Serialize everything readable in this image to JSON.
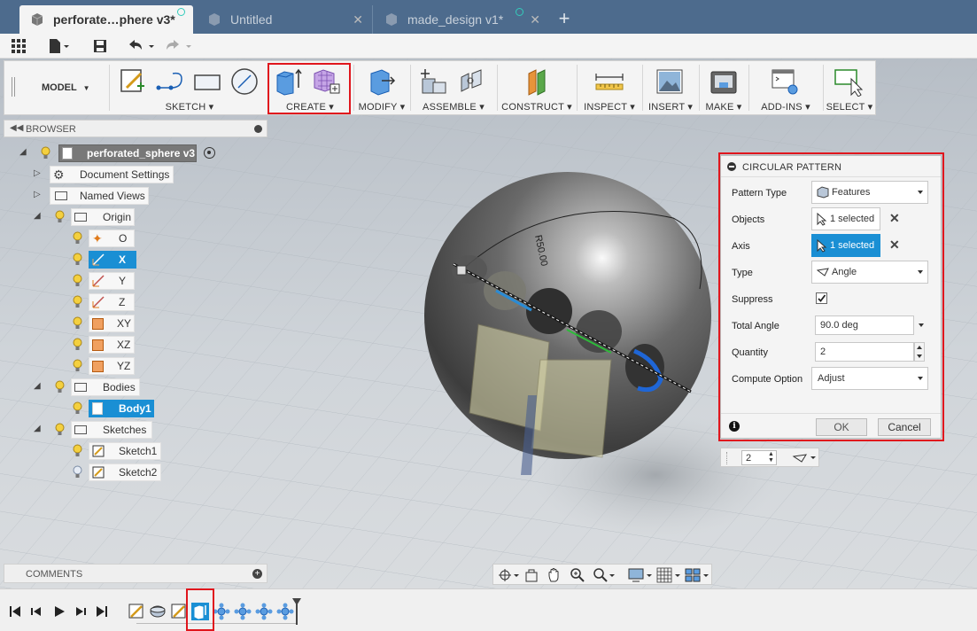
{
  "tabs": [
    {
      "title": "perforate…phere v3*",
      "active": true
    },
    {
      "title": "Untitled",
      "active": false
    },
    {
      "title": "made_design v1*",
      "active": false
    }
  ],
  "workspace": "MODEL",
  "ribbon": {
    "groups": [
      "SKETCH",
      "CREATE",
      "MODIFY",
      "ASSEMBLE",
      "CONSTRUCT",
      "INSPECT",
      "INSERT",
      "MAKE",
      "ADD-INS",
      "SELECT"
    ]
  },
  "browser": {
    "title": "BROWSER",
    "root": "perforated_sphere v3",
    "items": {
      "document_settings": "Document Settings",
      "named_views": "Named Views",
      "origin": "Origin",
      "o": "O",
      "x": "X",
      "y": "Y",
      "z": "Z",
      "xy": "XY",
      "xz": "XZ",
      "yz": "YZ",
      "bodies": "Bodies",
      "body1": "Body1",
      "sketches": "Sketches",
      "sketch1": "Sketch1",
      "sketch2": "Sketch2"
    }
  },
  "comments": {
    "title": "COMMENTS"
  },
  "dimension_label": "R50.00",
  "dialog": {
    "title": "CIRCULAR PATTERN",
    "pattern_type_label": "Pattern Type",
    "pattern_type_value": "Features",
    "objects_label": "Objects",
    "objects_value": "1 selected",
    "axis_label": "Axis",
    "axis_value": "1 selected",
    "type_label": "Type",
    "type_value": "Angle",
    "suppress_label": "Suppress",
    "suppress_checked": true,
    "total_angle_label": "Total Angle",
    "total_angle_value": "90.0 deg",
    "quantity_label": "Quantity",
    "quantity_value": "2",
    "compute_option_label": "Compute Option",
    "compute_option_value": "Adjust",
    "ok_label": "OK",
    "cancel_label": "Cancel"
  },
  "hud": {
    "quantity": "2"
  },
  "colors": {
    "accent": "#1a8fd4",
    "highlight": "#e0161d",
    "tabbar": "#4d6b8d"
  }
}
